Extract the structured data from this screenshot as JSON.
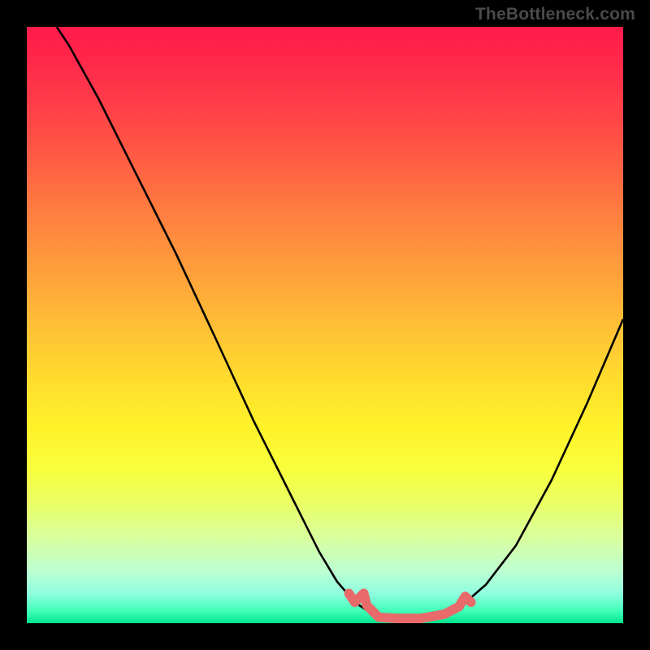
{
  "watermark": "TheBottleneck.com",
  "colors": {
    "page_bg": "#000000",
    "curve": "#000000",
    "highlight": "#e86a6a",
    "watermark_text": "#4a4a4a"
  },
  "chart_data": {
    "type": "line",
    "title": "",
    "xlabel": "",
    "ylabel": "",
    "xlim": [
      0,
      100
    ],
    "ylim": [
      0,
      100
    ],
    "grid": false,
    "legend": false,
    "gradient_direction": "vertical",
    "gradient_stops": [
      {
        "pos": 0,
        "color": "#ff1a4b"
      },
      {
        "pos": 33,
        "color": "#ff843f"
      },
      {
        "pos": 67,
        "color": "#fff229"
      },
      {
        "pos": 100,
        "color": "#00e48c"
      }
    ],
    "series": [
      {
        "name": "curve",
        "color": "#000000",
        "points": [
          {
            "x": 5.0,
            "y": 100.0
          },
          {
            "x": 7.0,
            "y": 97.0
          },
          {
            "x": 12.0,
            "y": 88.0
          },
          {
            "x": 18.0,
            "y": 76.0
          },
          {
            "x": 25.0,
            "y": 62.0
          },
          {
            "x": 32.0,
            "y": 47.0
          },
          {
            "x": 38.0,
            "y": 34.0
          },
          {
            "x": 44.0,
            "y": 22.0
          },
          {
            "x": 49.0,
            "y": 12.0
          },
          {
            "x": 52.0,
            "y": 7.0
          },
          {
            "x": 55.0,
            "y": 3.5
          },
          {
            "x": 58.0,
            "y": 1.5
          },
          {
            "x": 62.0,
            "y": 0.8
          },
          {
            "x": 66.0,
            "y": 0.8
          },
          {
            "x": 70.0,
            "y": 1.5
          },
          {
            "x": 73.0,
            "y": 3.0
          },
          {
            "x": 77.0,
            "y": 6.5
          },
          {
            "x": 82.0,
            "y": 13.0
          },
          {
            "x": 88.0,
            "y": 24.0
          },
          {
            "x": 94.0,
            "y": 37.0
          },
          {
            "x": 100.0,
            "y": 51.0
          }
        ]
      }
    ],
    "highlight_segment": {
      "color": "#e86a6a",
      "width_plot_units": 1.6,
      "points": [
        {
          "x": 54.0,
          "y": 5.0
        },
        {
          "x": 55.0,
          "y": 3.5
        },
        {
          "x": 56.5,
          "y": 5.0
        },
        {
          "x": 57.0,
          "y": 3.0
        },
        {
          "x": 59.0,
          "y": 1.0
        },
        {
          "x": 62.0,
          "y": 0.8
        },
        {
          "x": 66.0,
          "y": 0.8
        },
        {
          "x": 70.0,
          "y": 1.5
        },
        {
          "x": 72.5,
          "y": 2.8
        },
        {
          "x": 73.5,
          "y": 4.5
        },
        {
          "x": 74.5,
          "y": 3.5
        }
      ]
    }
  }
}
